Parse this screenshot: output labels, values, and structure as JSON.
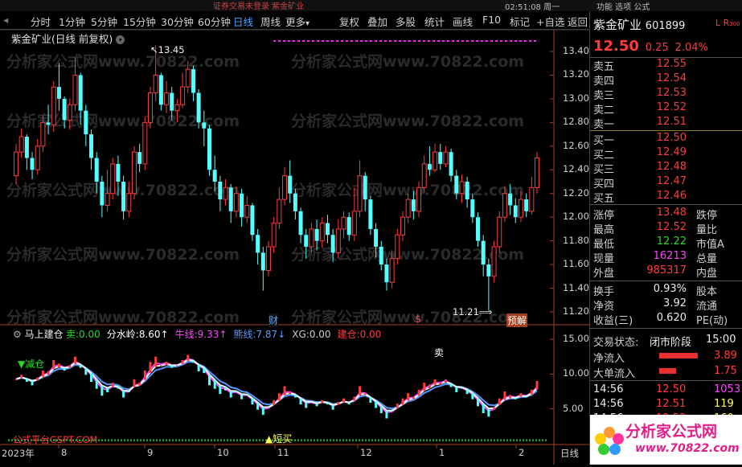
{
  "top_bar": {
    "center_text": "证券交易未登录  紫金矿业",
    "clock": "02:51:08 周一",
    "menu": "功能  选项  公式"
  },
  "toolbar": {
    "periods": [
      "分时",
      "1分钟",
      "5分钟",
      "15分钟",
      "30分钟",
      "60分钟",
      "日线",
      "周线",
      "更多"
    ],
    "active_period": "日线",
    "more_arrow": "▾",
    "actions": [
      "复权",
      "叠加",
      "多股",
      "统计",
      "画线",
      "F10",
      "标记",
      "+自选",
      "返回"
    ]
  },
  "chart": {
    "title": "紫金矿业(日线 前复权)",
    "high_label": "13.45",
    "low_label": "11.21",
    "y_ticks": [
      "13.40",
      "13.20",
      "13.00",
      "12.80",
      "12.60",
      "12.40",
      "12.20",
      "12.00",
      "11.80",
      "11.60",
      "11.40",
      "11.20"
    ],
    "markers": {
      "cai": "财",
      "s": "$",
      "yujie": "预解"
    },
    "watermark": "分析家公式网www.70822.com",
    "candles": [
      {
        "o": 12.35,
        "c": 12.55,
        "h": 12.62,
        "l": 12.28
      },
      {
        "o": 12.55,
        "c": 12.68,
        "h": 12.75,
        "l": 12.5
      },
      {
        "o": 12.68,
        "c": 12.5,
        "h": 12.7,
        "l": 12.4
      },
      {
        "o": 12.5,
        "c": 12.4,
        "h": 12.55,
        "l": 12.32
      },
      {
        "o": 12.4,
        "c": 12.6,
        "h": 12.66,
        "l": 12.36
      },
      {
        "o": 12.6,
        "c": 12.8,
        "h": 12.86,
        "l": 12.55
      },
      {
        "o": 12.8,
        "c": 12.78,
        "h": 12.95,
        "l": 12.7
      },
      {
        "o": 12.78,
        "c": 13.1,
        "h": 13.15,
        "l": 12.72
      },
      {
        "o": 13.1,
        "c": 13.0,
        "h": 13.3,
        "l": 12.9
      },
      {
        "o": 13.0,
        "c": 12.82,
        "h": 13.02,
        "l": 12.75
      },
      {
        "o": 12.82,
        "c": 12.95,
        "h": 13.0,
        "l": 12.74
      },
      {
        "o": 12.95,
        "c": 13.2,
        "h": 13.35,
        "l": 12.9
      },
      {
        "o": 13.2,
        "c": 12.9,
        "h": 13.22,
        "l": 12.78
      },
      {
        "o": 12.9,
        "c": 12.7,
        "h": 12.95,
        "l": 12.6
      },
      {
        "o": 12.7,
        "c": 12.5,
        "h": 12.74,
        "l": 12.4
      },
      {
        "o": 12.5,
        "c": 12.3,
        "h": 12.55,
        "l": 12.2
      },
      {
        "o": 12.3,
        "c": 12.1,
        "h": 12.35,
        "l": 12.0
      },
      {
        "o": 12.1,
        "c": 12.2,
        "h": 12.4,
        "l": 12.05
      },
      {
        "o": 12.2,
        "c": 12.45,
        "h": 12.5,
        "l": 12.15
      },
      {
        "o": 12.45,
        "c": 12.3,
        "h": 12.52,
        "l": 12.18
      },
      {
        "o": 12.3,
        "c": 12.05,
        "h": 12.35,
        "l": 11.98
      },
      {
        "o": 12.05,
        "c": 12.2,
        "h": 12.3,
        "l": 12.0
      },
      {
        "o": 12.2,
        "c": 12.55,
        "h": 12.6,
        "l": 12.15
      },
      {
        "o": 12.55,
        "c": 12.45,
        "h": 12.62,
        "l": 12.38
      },
      {
        "o": 12.45,
        "c": 12.8,
        "h": 12.85,
        "l": 12.4
      },
      {
        "o": 12.8,
        "c": 13.05,
        "h": 13.1,
        "l": 12.75
      },
      {
        "o": 13.05,
        "c": 13.2,
        "h": 13.45,
        "l": 12.98
      },
      {
        "o": 13.2,
        "c": 12.95,
        "h": 13.22,
        "l": 12.9
      },
      {
        "o": 12.95,
        "c": 13.05,
        "h": 13.15,
        "l": 12.88
      },
      {
        "o": 13.05,
        "c": 12.9,
        "h": 13.1,
        "l": 12.82
      },
      {
        "o": 12.9,
        "c": 12.95,
        "h": 13.0,
        "l": 12.8
      },
      {
        "o": 12.95,
        "c": 13.1,
        "h": 13.22,
        "l": 12.92
      },
      {
        "o": 13.1,
        "c": 13.25,
        "h": 13.32,
        "l": 13.05
      },
      {
        "o": 13.25,
        "c": 13.05,
        "h": 13.28,
        "l": 12.98
      },
      {
        "o": 13.05,
        "c": 12.8,
        "h": 13.08,
        "l": 12.75
      },
      {
        "o": 12.8,
        "c": 12.75,
        "h": 12.9,
        "l": 12.6
      },
      {
        "o": 12.75,
        "c": 12.4,
        "h": 12.78,
        "l": 12.35
      },
      {
        "o": 12.4,
        "c": 12.3,
        "h": 12.52,
        "l": 12.22
      },
      {
        "o": 12.3,
        "c": 12.15,
        "h": 12.35,
        "l": 12.05
      },
      {
        "o": 12.15,
        "c": 12.25,
        "h": 12.32,
        "l": 12.1
      },
      {
        "o": 12.25,
        "c": 12.05,
        "h": 12.28,
        "l": 11.95
      },
      {
        "o": 12.05,
        "c": 12.2,
        "h": 12.26,
        "l": 12.0
      },
      {
        "o": 12.2,
        "c": 12.0,
        "h": 12.24,
        "l": 11.92
      },
      {
        "o": 12.0,
        "c": 12.1,
        "h": 12.18,
        "l": 11.95
      },
      {
        "o": 12.1,
        "c": 11.85,
        "h": 12.12,
        "l": 11.8
      },
      {
        "o": 11.85,
        "c": 11.7,
        "h": 11.9,
        "l": 11.6
      },
      {
        "o": 11.7,
        "c": 11.55,
        "h": 11.75,
        "l": 11.38
      },
      {
        "o": 11.55,
        "c": 11.75,
        "h": 11.8,
        "l": 11.5
      },
      {
        "o": 11.75,
        "c": 11.95,
        "h": 12.0,
        "l": 11.7
      },
      {
        "o": 11.95,
        "c": 12.15,
        "h": 12.25,
        "l": 11.9
      },
      {
        "o": 12.15,
        "c": 12.35,
        "h": 12.42,
        "l": 12.1
      },
      {
        "o": 12.35,
        "c": 12.2,
        "h": 12.48,
        "l": 12.12
      },
      {
        "o": 12.2,
        "c": 12.05,
        "h": 12.24,
        "l": 11.98
      },
      {
        "o": 12.05,
        "c": 11.85,
        "h": 12.08,
        "l": 11.78
      },
      {
        "o": 11.85,
        "c": 11.75,
        "h": 11.9,
        "l": 11.65
      },
      {
        "o": 11.75,
        "c": 11.9,
        "h": 11.95,
        "l": 11.7
      },
      {
        "o": 11.9,
        "c": 11.8,
        "h": 11.98,
        "l": 11.72
      },
      {
        "o": 11.8,
        "c": 11.95,
        "h": 12.0,
        "l": 11.74
      },
      {
        "o": 11.95,
        "c": 11.85,
        "h": 12.02,
        "l": 11.78
      },
      {
        "o": 11.85,
        "c": 11.7,
        "h": 11.9,
        "l": 11.62
      },
      {
        "o": 11.7,
        "c": 11.9,
        "h": 11.98,
        "l": 11.65
      },
      {
        "o": 11.9,
        "c": 12.0,
        "h": 12.05,
        "l": 11.82
      },
      {
        "o": 12.0,
        "c": 11.85,
        "h": 12.04,
        "l": 11.8
      },
      {
        "o": 11.85,
        "c": 12.05,
        "h": 12.25,
        "l": 11.8
      },
      {
        "o": 12.05,
        "c": 12.35,
        "h": 12.48,
        "l": 12.0
      },
      {
        "o": 12.35,
        "c": 12.15,
        "h": 12.38,
        "l": 12.05
      },
      {
        "o": 12.15,
        "c": 11.9,
        "h": 12.18,
        "l": 11.85
      },
      {
        "o": 11.9,
        "c": 11.75,
        "h": 11.95,
        "l": 11.66
      },
      {
        "o": 11.75,
        "c": 11.6,
        "h": 11.8,
        "l": 11.55
      },
      {
        "o": 11.6,
        "c": 11.45,
        "h": 11.65,
        "l": 11.38
      },
      {
        "o": 11.45,
        "c": 11.65,
        "h": 11.72,
        "l": 11.4
      },
      {
        "o": 11.65,
        "c": 11.85,
        "h": 11.9,
        "l": 11.6
      },
      {
        "o": 11.85,
        "c": 12.0,
        "h": 12.05,
        "l": 11.8
      },
      {
        "o": 12.0,
        "c": 12.15,
        "h": 12.2,
        "l": 11.95
      },
      {
        "o": 12.15,
        "c": 12.05,
        "h": 12.22,
        "l": 11.98
      },
      {
        "o": 12.05,
        "c": 12.25,
        "h": 12.3,
        "l": 12.0
      },
      {
        "o": 12.25,
        "c": 12.45,
        "h": 12.52,
        "l": 12.2
      },
      {
        "o": 12.45,
        "c": 12.4,
        "h": 12.6,
        "l": 12.35
      },
      {
        "o": 12.4,
        "c": 12.55,
        "h": 12.62,
        "l": 12.38
      },
      {
        "o": 12.55,
        "c": 12.45,
        "h": 12.62,
        "l": 12.4
      },
      {
        "o": 12.45,
        "c": 12.55,
        "h": 12.6,
        "l": 12.42
      },
      {
        "o": 12.55,
        "c": 12.35,
        "h": 12.58,
        "l": 12.3
      },
      {
        "o": 12.35,
        "c": 12.2,
        "h": 12.4,
        "l": 12.15
      },
      {
        "o": 12.2,
        "c": 12.3,
        "h": 12.36,
        "l": 12.12
      },
      {
        "o": 12.3,
        "c": 12.15,
        "h": 12.34,
        "l": 12.08
      },
      {
        "o": 12.15,
        "c": 12.0,
        "h": 12.2,
        "l": 11.95
      },
      {
        "o": 12.0,
        "c": 11.8,
        "h": 12.04,
        "l": 11.75
      },
      {
        "o": 11.8,
        "c": 11.6,
        "h": 11.85,
        "l": 11.5
      },
      {
        "o": 11.6,
        "c": 11.5,
        "h": 11.65,
        "l": 11.21
      },
      {
        "o": 11.5,
        "c": 11.75,
        "h": 11.8,
        "l": 11.45
      },
      {
        "o": 11.75,
        "c": 12.0,
        "h": 12.05,
        "l": 11.7
      },
      {
        "o": 12.0,
        "c": 12.2,
        "h": 12.26,
        "l": 11.96
      },
      {
        "o": 12.2,
        "c": 12.1,
        "h": 12.28,
        "l": 12.02
      },
      {
        "o": 12.1,
        "c": 12.0,
        "h": 12.16,
        "l": 11.95
      },
      {
        "o": 12.0,
        "c": 12.15,
        "h": 12.22,
        "l": 11.96
      },
      {
        "o": 12.15,
        "c": 12.05,
        "h": 12.2,
        "l": 12.0
      },
      {
        "o": 12.05,
        "c": 12.25,
        "h": 12.34,
        "l": 12.02
      },
      {
        "o": 12.25,
        "c": 12.5,
        "h": 12.55,
        "l": 12.2
      }
    ]
  },
  "indicator": {
    "name": "马上建仓",
    "fields": [
      {
        "label": "卖:",
        "value": "0.00",
        "color": "#22dd22"
      },
      {
        "label": "分水岭:",
        "value": "8.60",
        "arrow": "↑",
        "color": "#ffffff"
      },
      {
        "label": "牛线:",
        "value": "9.33",
        "arrow": "↑",
        "color": "#ff44ff"
      },
      {
        "label": "熊线:",
        "value": "7.87",
        "arrow": "↓",
        "color": "#5599ff"
      },
      {
        "label": "XG:",
        "value": "0.00",
        "color": "#cccccc"
      },
      {
        "label": "建仓:",
        "value": "0.00",
        "color": "#ff3b3b"
      }
    ],
    "y_ticks": [
      "15.00",
      "10.00",
      "5.00"
    ],
    "signals": {
      "reduce": "减仓",
      "sell": "卖",
      "short_buy": "短买"
    },
    "source_label": "公式平台GSPT.COM"
  },
  "x_axis": {
    "labels": [
      "2023年",
      "8",
      "9",
      "10",
      "11",
      "12",
      "1",
      "2"
    ],
    "cut_label": "日线"
  },
  "quote": {
    "name": "紫金矿业",
    "code": "601899",
    "flags": "L R",
    "flag_sub": "300",
    "price": "12.50",
    "change": "0.25",
    "change_pct": "2.04%",
    "asks": [
      {
        "label": "卖五",
        "price": "12.55"
      },
      {
        "label": "卖四",
        "price": "12.54"
      },
      {
        "label": "卖三",
        "price": "12.53"
      },
      {
        "label": "卖二",
        "price": "12.52"
      },
      {
        "label": "卖一",
        "price": "12.51"
      }
    ],
    "bids": [
      {
        "label": "买一",
        "price": "12.50"
      },
      {
        "label": "买二",
        "price": "12.49"
      },
      {
        "label": "买三",
        "price": "12.48"
      },
      {
        "label": "买四",
        "price": "12.47"
      },
      {
        "label": "买五",
        "price": "12.46"
      }
    ],
    "stats": [
      {
        "label": "涨停",
        "value": "13.48",
        "color": "#ff3b3b",
        "label2": "跌停"
      },
      {
        "label": "最高",
        "value": "12.52",
        "color": "#ff3b3b",
        "label2": "量比"
      },
      {
        "label": "最低",
        "value": "12.22",
        "color": "#22dd22",
        "label2": "市值A"
      },
      {
        "label": "现量",
        "value": "16213",
        "color": "#ff44ff",
        "label2": "总量"
      },
      {
        "label": "外盘",
        "value": "985317",
        "color": "#ff3b3b",
        "label2": "内盘"
      }
    ],
    "fundamentals": [
      {
        "label": "换手",
        "value": "0.93%",
        "label2": "股本"
      },
      {
        "label": "净资",
        "value": "3.92",
        "label2": "流通"
      },
      {
        "label": "收益(三)",
        "value": "0.620",
        "label2": "PE(动)"
      }
    ],
    "trade_status_label": "交易状态:",
    "trade_status": "闭市阶段",
    "trade_time": "15:00",
    "flows": [
      {
        "label": "净流入",
        "value": "3.89",
        "bar": 0.8
      },
      {
        "label": "大单流入",
        "value": "1.75",
        "bar": 0.35
      }
    ],
    "ticks": [
      {
        "time": "14:56",
        "price": "12.50",
        "vol": "1053",
        "vol_color": "#ff44ff"
      },
      {
        "time": "14:56",
        "price": "12.51",
        "vol": "119",
        "vol_color": "#ffff55"
      },
      {
        "time": "14:56",
        "price": "12.52",
        "vol": "160",
        "vol_color": "#ffff55"
      }
    ],
    "logo_text": "分析家公式网",
    "logo_url": "www.70822.com"
  }
}
